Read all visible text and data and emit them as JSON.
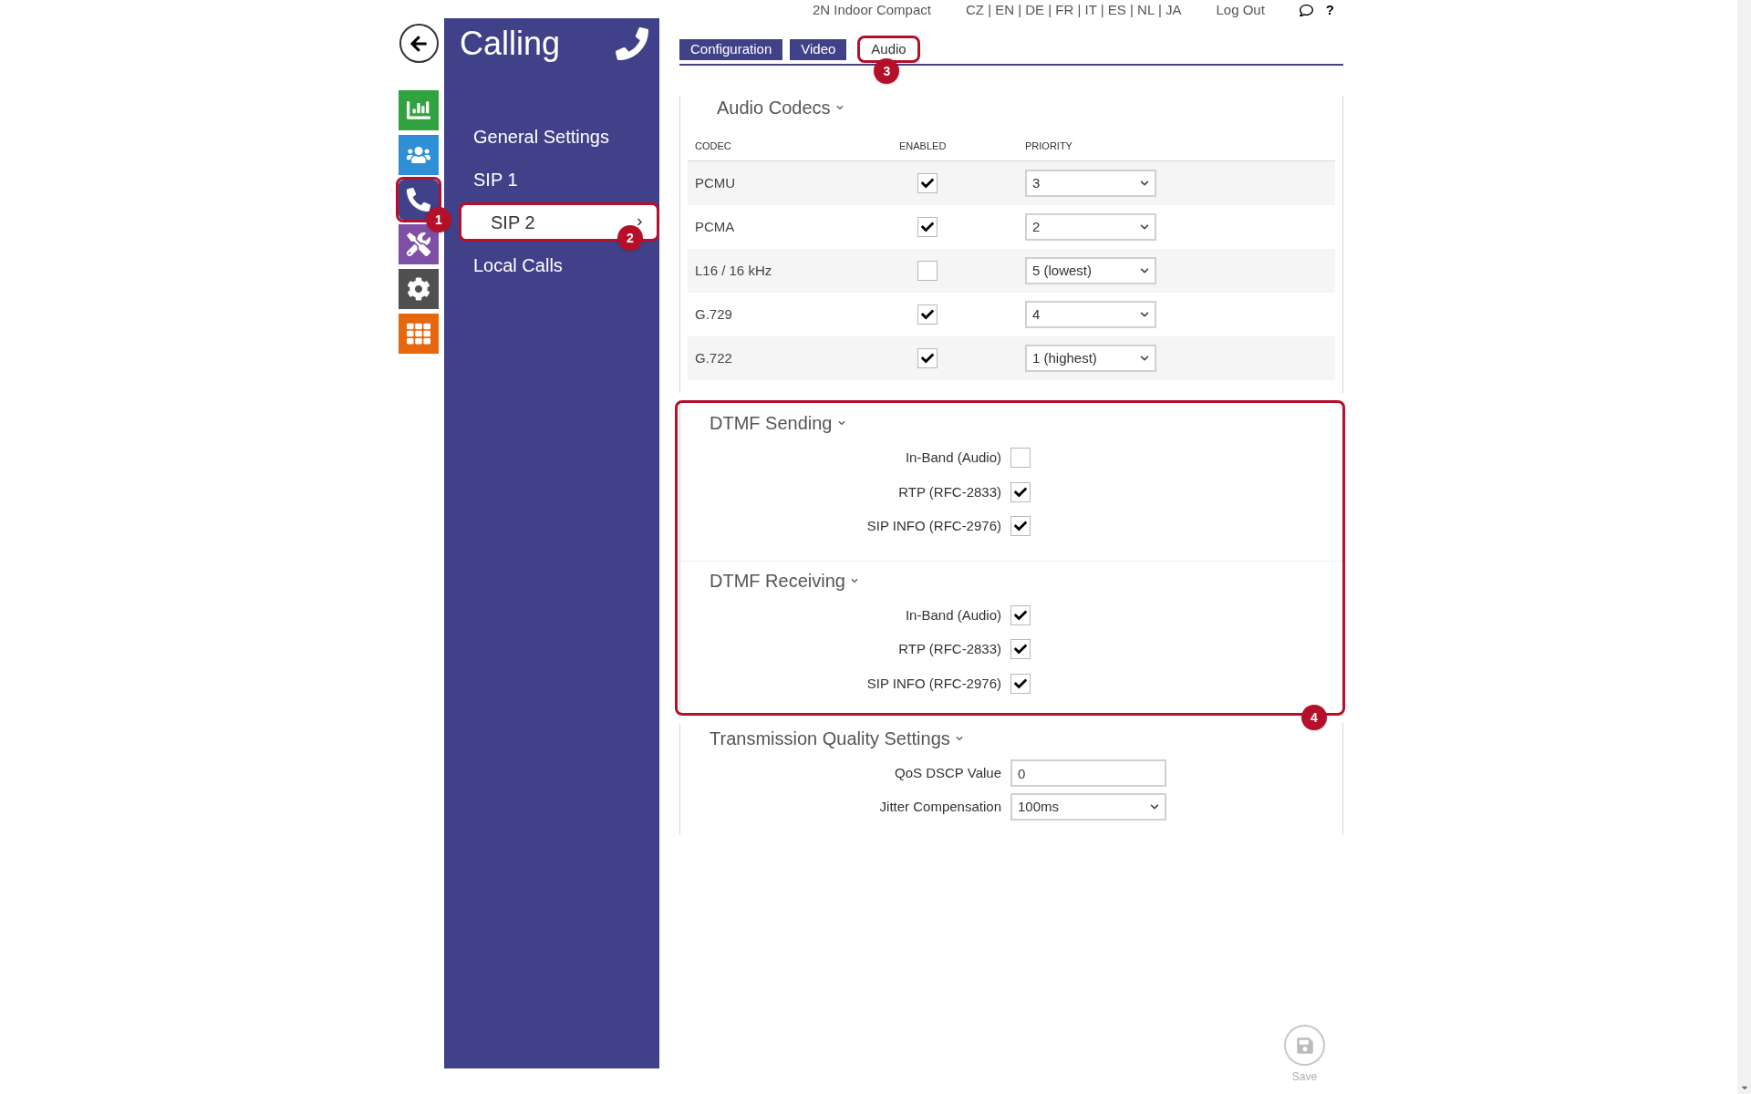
{
  "header": {
    "device": "2N Indoor Compact",
    "languages": "CZ | EN | DE | FR | IT | ES | NL | JA",
    "logout": "Log Out",
    "help": "?"
  },
  "nav": [
    {
      "kind": "back",
      "selected": false,
      "color": "#ffffff"
    },
    {
      "kind": "stats",
      "selected": false,
      "color": "#31a33e"
    },
    {
      "kind": "users",
      "selected": false,
      "color": "#2e8fd6"
    },
    {
      "kind": "calling",
      "selected": true,
      "color": "#41418a",
      "callout": "1"
    },
    {
      "kind": "tools",
      "selected": false,
      "color": "#7e4fa5"
    },
    {
      "kind": "settings",
      "selected": false,
      "color": "#505050"
    },
    {
      "kind": "apps",
      "selected": false,
      "color": "#e8660e"
    }
  ],
  "menu": {
    "title": "Calling",
    "items": [
      {
        "label": "General Settings",
        "selected": false
      },
      {
        "label": "SIP 1",
        "selected": false
      },
      {
        "label": "SIP 2",
        "selected": true,
        "callout": "2"
      },
      {
        "label": "Local Calls",
        "selected": false
      }
    ]
  },
  "tabs": [
    {
      "label": "Configuration",
      "selected": false
    },
    {
      "label": "Video",
      "selected": false
    },
    {
      "label": "Audio",
      "selected": true,
      "callout": "3"
    }
  ],
  "codecs": {
    "title": "Audio Codecs",
    "columns": [
      "CODEC",
      "ENABLED",
      "PRIORITY"
    ],
    "rows": [
      {
        "codec": "PCMU",
        "enabled": true,
        "priority": "3"
      },
      {
        "codec": "PCMA",
        "enabled": true,
        "priority": "2"
      },
      {
        "codec": "L16 / 16 kHz",
        "enabled": false,
        "priority": "5 (lowest)"
      },
      {
        "codec": "G.729",
        "enabled": true,
        "priority": "4"
      },
      {
        "codec": "G.722",
        "enabled": true,
        "priority": "1 (highest)"
      }
    ]
  },
  "dtmf": {
    "callout": "4",
    "sections": [
      {
        "title": "DTMF Sending",
        "options": [
          {
            "label": "In-Band (Audio)",
            "checked": false
          },
          {
            "label": "RTP (RFC-2833)",
            "checked": true
          },
          {
            "label": "SIP INFO (RFC-2976)",
            "checked": true
          }
        ]
      },
      {
        "title": "DTMF Receiving",
        "options": [
          {
            "label": "In-Band (Audio)",
            "checked": true
          },
          {
            "label": "RTP (RFC-2833)",
            "checked": true
          },
          {
            "label": "SIP INFO (RFC-2976)",
            "checked": true
          }
        ]
      }
    ]
  },
  "transmission": {
    "title": "Transmission Quality Settings",
    "fields": [
      {
        "kind": "text",
        "label": "QoS DSCP Value",
        "value": "0"
      },
      {
        "kind": "select",
        "label": "Jitter Compensation",
        "value": "100ms"
      }
    ]
  },
  "save": {
    "label": "Save",
    "disabled": true
  }
}
